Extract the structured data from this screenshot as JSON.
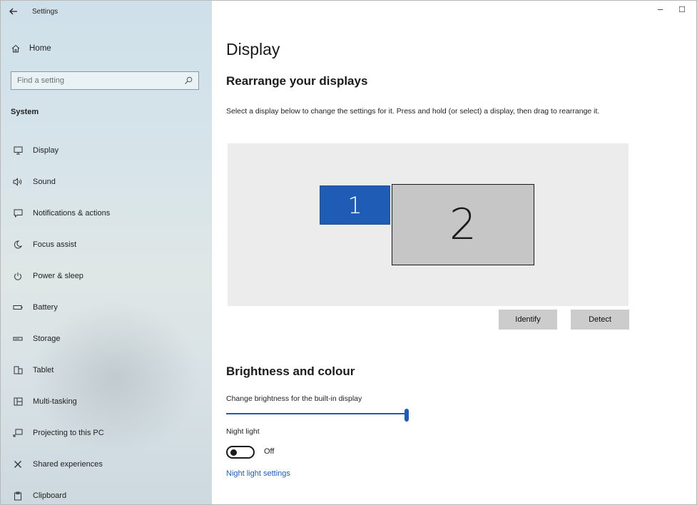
{
  "window": {
    "title": "Settings",
    "minimize_glyph": "–",
    "maximize_glyph": "☐"
  },
  "sidebar": {
    "back_icon": "arrow-left-icon",
    "home_label": "Home",
    "search_placeholder": "Find a setting",
    "section_title": "System",
    "items": [
      {
        "label": "Display",
        "icon": "monitor-icon"
      },
      {
        "label": "Sound",
        "icon": "speaker-icon"
      },
      {
        "label": "Notifications & actions",
        "icon": "notification-icon"
      },
      {
        "label": "Focus assist",
        "icon": "moon-icon"
      },
      {
        "label": "Power & sleep",
        "icon": "power-icon"
      },
      {
        "label": "Battery",
        "icon": "battery-icon"
      },
      {
        "label": "Storage",
        "icon": "storage-icon"
      },
      {
        "label": "Tablet",
        "icon": "tablet-icon"
      },
      {
        "label": "Multi-tasking",
        "icon": "multitasking-icon"
      },
      {
        "label": "Projecting to this PC",
        "icon": "projecting-icon"
      },
      {
        "label": "Shared experiences",
        "icon": "shared-experiences-icon"
      },
      {
        "label": "Clipboard",
        "icon": "clipboard-icon"
      }
    ]
  },
  "main": {
    "page_title": "Display",
    "rearrange_heading": "Rearrange your displays",
    "rearrange_description": "Select a display below to change the settings for it. Press and hold (or select) a display, then drag to rearrange it.",
    "displays": [
      {
        "number": "1",
        "color": "#1f5cb5",
        "selected": true
      },
      {
        "number": "2",
        "color": "#c6c6c6",
        "selected": false
      }
    ],
    "identify_button": "Identify",
    "detect_button": "Detect",
    "brightness_heading": "Brightness and colour",
    "brightness_label": "Change brightness for the built-in display",
    "brightness_value_fraction": 1.0,
    "night_light_label": "Night light",
    "night_light_state": "Off",
    "night_light_settings_link": "Night light settings"
  },
  "colors": {
    "accent": "#1f5cb5",
    "sidebar_bg": "#d6e4ea",
    "button_bg": "#cccccc"
  }
}
